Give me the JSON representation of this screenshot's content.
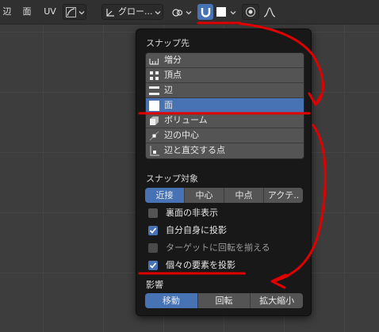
{
  "header": {
    "edge_label": "辺",
    "face_label": "面",
    "uv_label": "UV",
    "transform_orientation": "グロー...",
    "colors": {
      "active": "#4772b3",
      "bg": "#303030"
    }
  },
  "popover": {
    "snap_to_title": "スナップ先",
    "snap_to_items": [
      {
        "label": "増分",
        "icon": "increment-icon",
        "selected": false
      },
      {
        "label": "頂点",
        "icon": "vertex-icon",
        "selected": false
      },
      {
        "label": "辺",
        "icon": "edge-icon",
        "selected": false
      },
      {
        "label": "面",
        "icon": "face-icon",
        "selected": true
      },
      {
        "label": "ボリューム",
        "icon": "volume-icon",
        "selected": false
      },
      {
        "label": "辺の中心",
        "icon": "edge-center-icon",
        "selected": false
      },
      {
        "label": "辺と直交する点",
        "icon": "edge-perpendicular-icon",
        "selected": false
      }
    ],
    "snap_with_title": "スナップ対象",
    "snap_with": [
      {
        "label": "近接",
        "active": true
      },
      {
        "label": "中心",
        "active": false
      },
      {
        "label": "中点",
        "active": false
      },
      {
        "label": "アクテ..",
        "active": false
      }
    ],
    "options": [
      {
        "label": "裏面の非表示",
        "checked": false,
        "enabled": true
      },
      {
        "label": "自分自身に投影",
        "checked": true,
        "enabled": true
      },
      {
        "label": "ターゲットに回転を揃える",
        "checked": false,
        "enabled": false
      },
      {
        "label": "個々の要素を投影",
        "checked": true,
        "enabled": true
      }
    ],
    "affect_title": "影響",
    "affect": [
      {
        "label": "移動",
        "active": true
      },
      {
        "label": "回転",
        "active": false
      },
      {
        "label": "拡大縮小",
        "active": false
      }
    ]
  },
  "annotation_color": "#e00000"
}
